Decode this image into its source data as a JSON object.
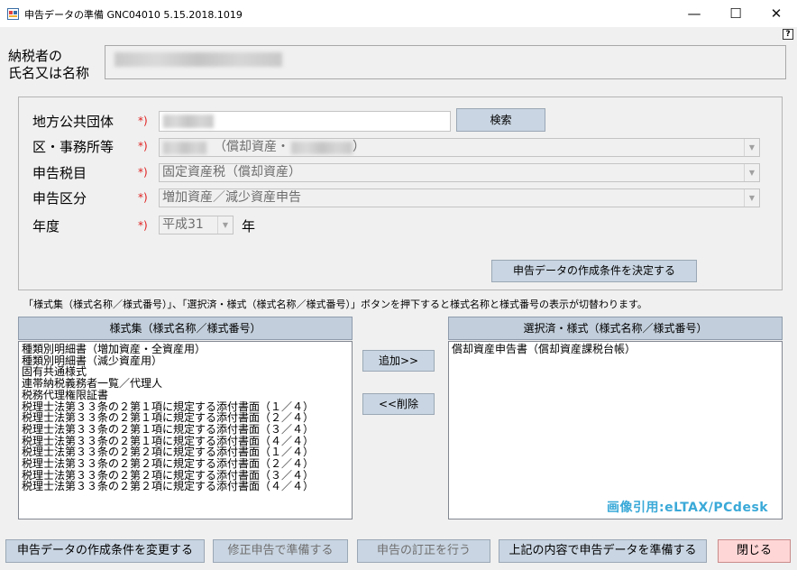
{
  "window": {
    "title": "申告データの準備 GNC04010  5.15.2018.1019",
    "minimize_glyph": "—",
    "maximize_glyph": "☐",
    "close_glyph": "✕",
    "help_glyph": "?"
  },
  "taxpayer": {
    "label_line1": "納税者の",
    "label_line2": "氏名又は名称"
  },
  "conditions": {
    "local_gov_label": "地方公共団体",
    "office_label": "区・事務所等",
    "tax_item_label": "申告税目",
    "category_label": "申告区分",
    "year_label": "年度",
    "required_mark": "*)",
    "search_button": "検索",
    "office_value_suffix": "（償却資産・",
    "office_value_close": "）",
    "tax_item_value": "固定資産税（償却資産）",
    "category_value": "増加資産／減少資産申告",
    "year_value": "平成31",
    "year_unit": "年",
    "decide_button": "申告データの作成条件を決定する"
  },
  "notice": "「様式集（様式名称／様式番号）」、「選択済・様式（様式名称／様式番号）」ボタンを押下すると様式名称と様式番号の表示が切替わります。",
  "forms": {
    "available_header": "様式集（様式名称／様式番号）",
    "selected_header": "選択済・様式（様式名称／様式番号）",
    "add_button": "追加>>",
    "remove_button": "<<削除",
    "available_items": [
      "種類別明細書（増加資産・全資産用）",
      "種類別明細書（減少資産用）",
      "固有共通様式",
      "連帯納税義務者一覧／代理人",
      "税務代理権限証書",
      "税理士法第３３条の２第１項に規定する添付書面（１／４）",
      "税理士法第３３条の２第１項に規定する添付書面（２／４）",
      "税理士法第３３条の２第１項に規定する添付書面（３／４）",
      "税理士法第３３条の２第１項に規定する添付書面（４／４）",
      "税理士法第３３条の２第２項に規定する添付書面（１／４）",
      "税理士法第３３条の２第２項に規定する添付書面（２／４）",
      "税理士法第３３条の２第２項に規定する添付書面（３／４）",
      "税理士法第３３条の２第２項に規定する添付書面（４／４）"
    ],
    "selected_items": [
      "償却資産申告書（償却資産課税台帳）"
    ]
  },
  "watermark": "画像引用:eLTAX/PCdesk",
  "footer": {
    "change_button": "申告データの作成条件を変更する",
    "amend_button": "修正申告で準備する",
    "correct_button": "申告の訂正を行う",
    "prepare_button": "上記の内容で申告データを準備する",
    "close_button": "閉じる"
  }
}
